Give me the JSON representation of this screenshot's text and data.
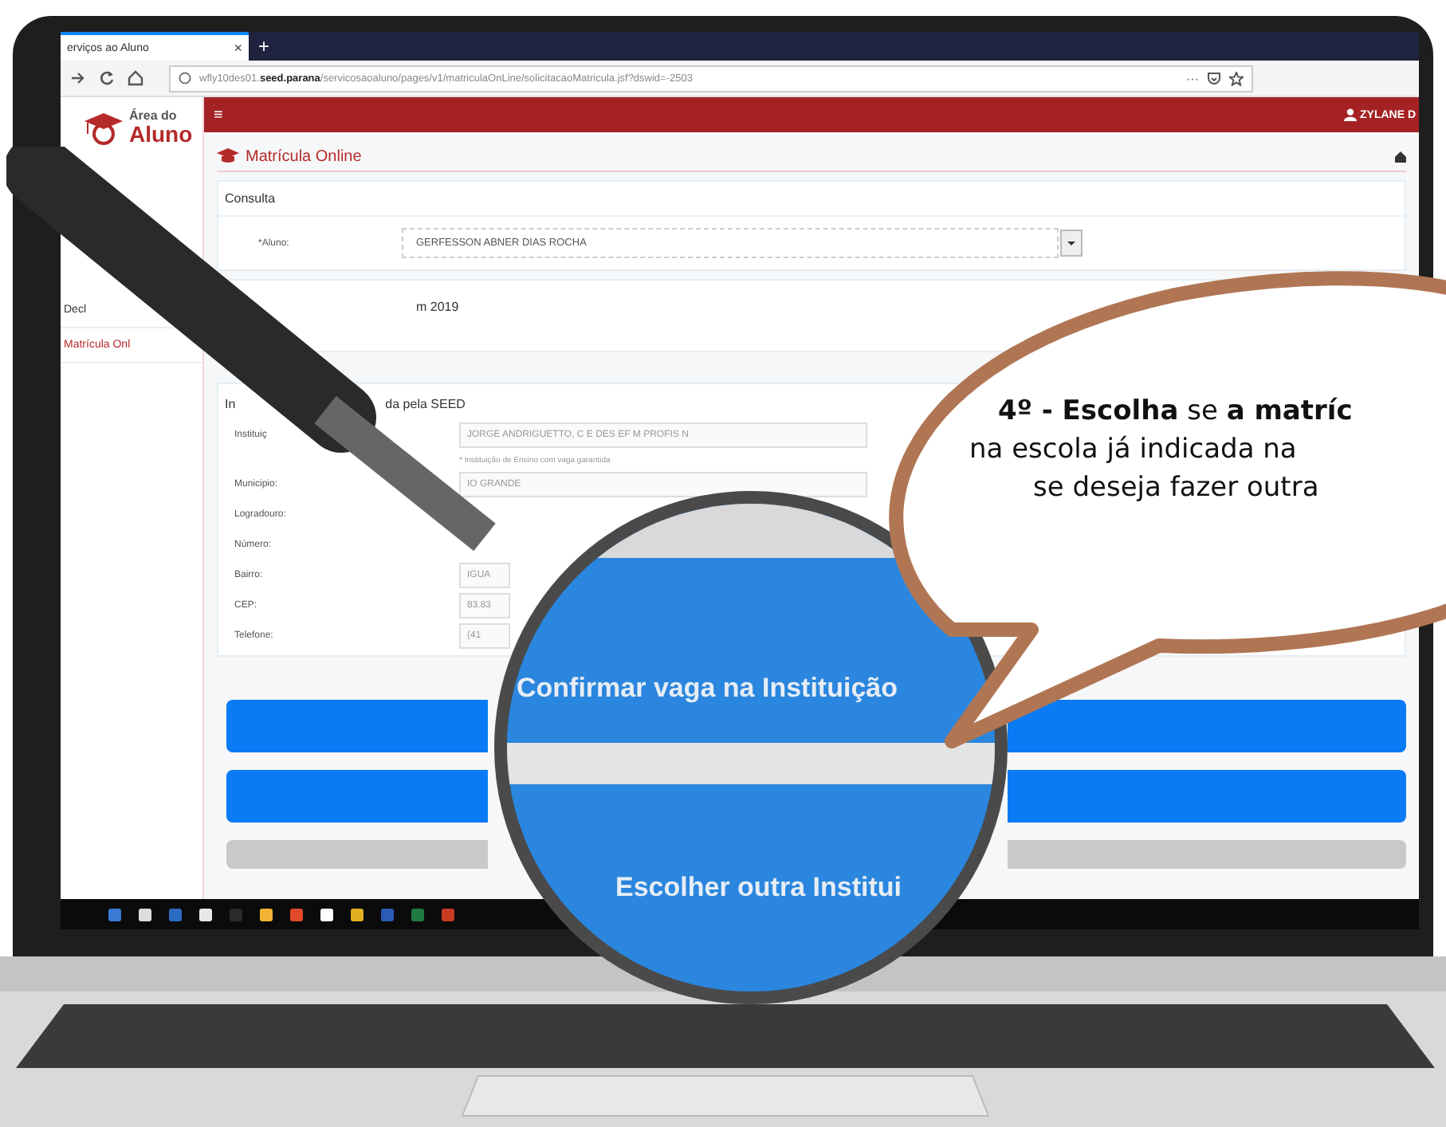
{
  "browser": {
    "tab": {
      "title": "erviços ao Aluno",
      "close": "×",
      "selected": true
    },
    "new_tab": "+",
    "url": "wfly10des01.**seed.parana**/servicosaoaluno/pages/v1/matriculaOnLine/solicitacaoMatricula.jsf?dswid=-2503",
    "more": "···"
  },
  "sidebar": {
    "logo": [
      "Área do",
      "Aluno"
    ],
    "items": [
      {
        "label": "Decl",
        "selected": false
      },
      {
        "label": "Matrícula Onl",
        "selected": true
      }
    ]
  },
  "header": {
    "menu": "≡",
    "user": "ZYLANE D"
  },
  "page_title": "Matrícula Online",
  "consulta": {
    "title": "Consulta",
    "label": "*Aluno:",
    "value": "GERFESSON ABNER DIAS ROCHA"
  },
  "year_section": "m 2019",
  "school": {
    "title_start": "In",
    "title_end": "da pela SEED",
    "fields": [
      {
        "label": "Instituiç",
        "value": "JORGE ANDRIGUETTO, C E DES EF M PROFIS N",
        "note": "* Instituição de Ensino com vaga garantida"
      },
      {
        "label": "Municipio:",
        "value": "IO GRANDE"
      },
      {
        "label": "Logradouro:"
      },
      {
        "label": "Número:"
      },
      {
        "label": "Bairro:",
        "value": "IGUA"
      },
      {
        "label": "CEP:",
        "value": "83.83"
      },
      {
        "label": "Telefone:",
        "value": "(41"
      }
    ]
  },
  "buttons": [
    {
      "kind": "primary"
    },
    {
      "kind": "primary"
    },
    {
      "kind": "secondary"
    }
  ],
  "lens": {
    "texts": [
      "Confirmar vaga na Instituição",
      "Escolher outra Institui"
    ]
  },
  "bubble": {
    "lines": [
      "**4º - Escolha** se **a matríc**",
      "na escola já indicada na",
      "se deseja fazer outra"
    ]
  }
}
